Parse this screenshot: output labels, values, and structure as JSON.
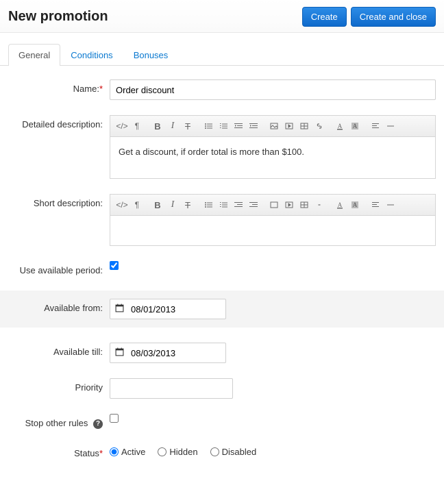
{
  "header": {
    "title": "New promotion",
    "create_label": "Create",
    "create_close_label": "Create and close"
  },
  "tabs": [
    {
      "label": "General",
      "active": true
    },
    {
      "label": "Conditions",
      "active": false
    },
    {
      "label": "Bonuses",
      "active": false
    }
  ],
  "form": {
    "name": {
      "label": "Name:",
      "value": "Order discount"
    },
    "detailed_desc": {
      "label": "Detailed description:",
      "content": "Get a discount, if order total is more than $100."
    },
    "short_desc": {
      "label": "Short description:",
      "content": ""
    },
    "use_period": {
      "label": "Use available period:",
      "checked": true
    },
    "avail_from": {
      "label": "Available from:",
      "value": "08/01/2013"
    },
    "avail_till": {
      "label": "Available till:",
      "value": "08/03/2013"
    },
    "priority": {
      "label": "Priority",
      "value": ""
    },
    "stop_rules": {
      "label": "Stop other rules",
      "checked": false
    },
    "status": {
      "label": "Status",
      "options": [
        {
          "label": "Active",
          "value": "A",
          "checked": true
        },
        {
          "label": "Hidden",
          "value": "H",
          "checked": false
        },
        {
          "label": "Disabled",
          "value": "D",
          "checked": false
        }
      ]
    }
  },
  "rte_buttons": {
    "code": "</>",
    "para": "¶",
    "bold": "B",
    "italic": "I",
    "strike": "T"
  }
}
